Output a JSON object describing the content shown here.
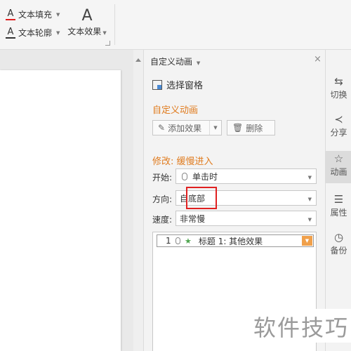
{
  "ribbon": {
    "text_fill": {
      "label": "文本填充",
      "icon": "A-red-underline-icon"
    },
    "text_outline": {
      "label": "文本轮廓",
      "icon": "A-outline-icon"
    },
    "text_effect": {
      "label": "文本效果",
      "icon": "A-effect-icon"
    }
  },
  "pane": {
    "title": "自定义动画",
    "close": "×",
    "select_pane": "选择窗格",
    "section_title": "自定义动画",
    "add_effect": "添加效果",
    "delete": "删除",
    "modify_title": "修改: 缓慢进入",
    "start_label": "开始:",
    "start_value": "单击时",
    "direction_label": "方向:",
    "direction_value": "自底部",
    "speed_label": "速度:",
    "speed_value": "非常慢",
    "list": [
      {
        "num": "1",
        "text": "标题 1: 其他效果"
      }
    ]
  },
  "rail": {
    "items": [
      {
        "label": "切换",
        "icon": "switch-icon",
        "glyph": "⇆"
      },
      {
        "label": "分享",
        "icon": "share-icon",
        "glyph": "≺"
      },
      {
        "label": "动画",
        "icon": "animation-star-icon",
        "glyph": "☆"
      },
      {
        "label": "属性",
        "icon": "properties-sliders-icon",
        "glyph": "☰"
      },
      {
        "label": "备份",
        "icon": "backup-clock-icon",
        "glyph": "◷"
      }
    ]
  },
  "watermark": "软件技巧",
  "colors": {
    "accent": "#e07b1e",
    "highlight": "#e02020",
    "list_dropdown": "#f0a04b"
  }
}
